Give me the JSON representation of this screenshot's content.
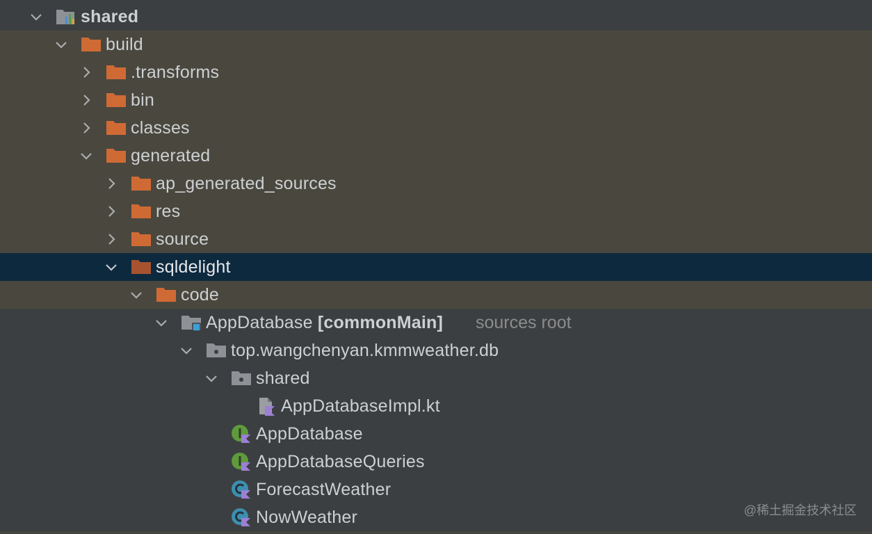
{
  "tree": {
    "root": {
      "label": "shared"
    },
    "build": {
      "label": "build"
    },
    "transforms": {
      "label": ".transforms"
    },
    "bin": {
      "label": "bin"
    },
    "classes": {
      "label": "classes"
    },
    "generated": {
      "label": "generated"
    },
    "ap_generated_sources": {
      "label": "ap_generated_sources"
    },
    "res": {
      "label": "res"
    },
    "source": {
      "label": "source"
    },
    "sqldelight": {
      "label": "sqldelight"
    },
    "code": {
      "label": "code"
    },
    "app_database_root": {
      "label": "AppDatabase",
      "qualifier": "[commonMain]",
      "suffix": "sources root"
    },
    "package": {
      "label": "top.wangchenyan.kmmweather.db"
    },
    "shared_pkg": {
      "label": "shared"
    },
    "impl_file": {
      "label": "AppDatabaseImpl.kt"
    },
    "app_database": {
      "label": "AppDatabase"
    },
    "app_database_queries": {
      "label": "AppDatabaseQueries"
    },
    "forecast_weather": {
      "label": "ForecastWeather"
    },
    "now_weather": {
      "label": "NowWeather"
    }
  },
  "watermark": "@稀土掘金技术社区",
  "colors": {
    "folder": "#d06a35",
    "selected_bg": "#0d293e",
    "build_bg": "#4a483e",
    "panel_bg": "#3c3f41",
    "text": "#cdd0d3",
    "muted_text": "#8c8c8c",
    "interface_icon": "#5f9b3c",
    "class_icon": "#3d8fb0",
    "kotlin_badge": "#9d7fd6"
  },
  "icons": {
    "expanded": "chevron-down-icon",
    "collapsed": "chevron-right-icon",
    "module": "module-icon",
    "folder": "folder-icon",
    "source_root": "source-root-icon",
    "package": "package-icon",
    "kotlin_file": "kotlin-file-icon",
    "kotlin_interface": "kotlin-interface-icon",
    "kotlin_class": "kotlin-class-icon"
  }
}
